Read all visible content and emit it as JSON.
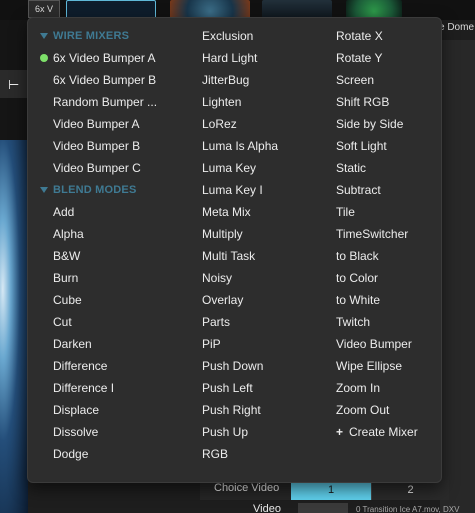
{
  "top_tab": "6x V",
  "right_clip_label": "e Dome I",
  "choice": {
    "label": "Choice Video",
    "cell1": "1",
    "cell2": "2"
  },
  "video": {
    "label": "Video",
    "file": "0 Transition Ice A7.mov, DXV"
  },
  "menu": {
    "sections": {
      "wire_mixers": "WIRE MIXERS",
      "blend_modes": "BLEND MODES"
    },
    "wire_mixers": [
      "6x Video Bumper A",
      "6x Video Bumper B",
      "Random Bumper ...",
      "Video Bumper A",
      "Video Bumper B",
      "Video Bumper C"
    ],
    "col1_blend": [
      "Add",
      "Alpha",
      "B&W",
      "Burn",
      "Cube",
      "Cut",
      "Darken",
      "Difference",
      "Difference I",
      "Displace",
      "Dissolve",
      "Dodge"
    ],
    "col2": [
      "Exclusion",
      "Hard Light",
      "JitterBug",
      "Lighten",
      "LoRez",
      "Luma Is Alpha",
      "Luma Key",
      "Luma Key I",
      "Meta Mix",
      "Multiply",
      "Multi Task",
      "Noisy",
      "Overlay",
      "Parts",
      "PiP",
      "Push Down",
      "Push Left",
      "Push Right",
      "Push Up",
      "RGB"
    ],
    "col3": [
      "Rotate X",
      "Rotate Y",
      "Screen",
      "Shift RGB",
      "Side by Side",
      "Soft Light",
      "Static",
      "Subtract",
      "Tile",
      "TimeSwitcher",
      "to Black",
      "to Color",
      "to White",
      "Twitch",
      "Video Bumper",
      "Wipe Ellipse",
      "Zoom In",
      "Zoom Out"
    ],
    "create_mixer": "Create Mixer",
    "selected_indicator_color": "#7ee06a",
    "section_color": "#3f7a93"
  }
}
